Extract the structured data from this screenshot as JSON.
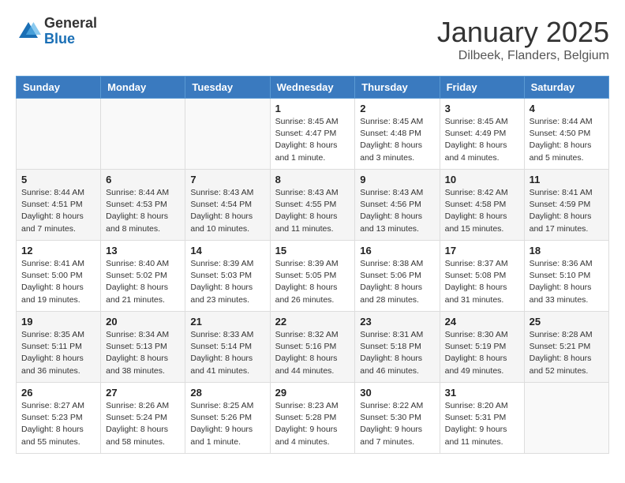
{
  "header": {
    "logo_general": "General",
    "logo_blue": "Blue",
    "month_title": "January 2025",
    "location": "Dilbeek, Flanders, Belgium"
  },
  "days_of_week": [
    "Sunday",
    "Monday",
    "Tuesday",
    "Wednesday",
    "Thursday",
    "Friday",
    "Saturday"
  ],
  "weeks": [
    [
      {
        "day": "",
        "info": ""
      },
      {
        "day": "",
        "info": ""
      },
      {
        "day": "",
        "info": ""
      },
      {
        "day": "1",
        "info": "Sunrise: 8:45 AM\nSunset: 4:47 PM\nDaylight: 8 hours\nand 1 minute."
      },
      {
        "day": "2",
        "info": "Sunrise: 8:45 AM\nSunset: 4:48 PM\nDaylight: 8 hours\nand 3 minutes."
      },
      {
        "day": "3",
        "info": "Sunrise: 8:45 AM\nSunset: 4:49 PM\nDaylight: 8 hours\nand 4 minutes."
      },
      {
        "day": "4",
        "info": "Sunrise: 8:44 AM\nSunset: 4:50 PM\nDaylight: 8 hours\nand 5 minutes."
      }
    ],
    [
      {
        "day": "5",
        "info": "Sunrise: 8:44 AM\nSunset: 4:51 PM\nDaylight: 8 hours\nand 7 minutes."
      },
      {
        "day": "6",
        "info": "Sunrise: 8:44 AM\nSunset: 4:53 PM\nDaylight: 8 hours\nand 8 minutes."
      },
      {
        "day": "7",
        "info": "Sunrise: 8:43 AM\nSunset: 4:54 PM\nDaylight: 8 hours\nand 10 minutes."
      },
      {
        "day": "8",
        "info": "Sunrise: 8:43 AM\nSunset: 4:55 PM\nDaylight: 8 hours\nand 11 minutes."
      },
      {
        "day": "9",
        "info": "Sunrise: 8:43 AM\nSunset: 4:56 PM\nDaylight: 8 hours\nand 13 minutes."
      },
      {
        "day": "10",
        "info": "Sunrise: 8:42 AM\nSunset: 4:58 PM\nDaylight: 8 hours\nand 15 minutes."
      },
      {
        "day": "11",
        "info": "Sunrise: 8:41 AM\nSunset: 4:59 PM\nDaylight: 8 hours\nand 17 minutes."
      }
    ],
    [
      {
        "day": "12",
        "info": "Sunrise: 8:41 AM\nSunset: 5:00 PM\nDaylight: 8 hours\nand 19 minutes."
      },
      {
        "day": "13",
        "info": "Sunrise: 8:40 AM\nSunset: 5:02 PM\nDaylight: 8 hours\nand 21 minutes."
      },
      {
        "day": "14",
        "info": "Sunrise: 8:39 AM\nSunset: 5:03 PM\nDaylight: 8 hours\nand 23 minutes."
      },
      {
        "day": "15",
        "info": "Sunrise: 8:39 AM\nSunset: 5:05 PM\nDaylight: 8 hours\nand 26 minutes."
      },
      {
        "day": "16",
        "info": "Sunrise: 8:38 AM\nSunset: 5:06 PM\nDaylight: 8 hours\nand 28 minutes."
      },
      {
        "day": "17",
        "info": "Sunrise: 8:37 AM\nSunset: 5:08 PM\nDaylight: 8 hours\nand 31 minutes."
      },
      {
        "day": "18",
        "info": "Sunrise: 8:36 AM\nSunset: 5:10 PM\nDaylight: 8 hours\nand 33 minutes."
      }
    ],
    [
      {
        "day": "19",
        "info": "Sunrise: 8:35 AM\nSunset: 5:11 PM\nDaylight: 8 hours\nand 36 minutes."
      },
      {
        "day": "20",
        "info": "Sunrise: 8:34 AM\nSunset: 5:13 PM\nDaylight: 8 hours\nand 38 minutes."
      },
      {
        "day": "21",
        "info": "Sunrise: 8:33 AM\nSunset: 5:14 PM\nDaylight: 8 hours\nand 41 minutes."
      },
      {
        "day": "22",
        "info": "Sunrise: 8:32 AM\nSunset: 5:16 PM\nDaylight: 8 hours\nand 44 minutes."
      },
      {
        "day": "23",
        "info": "Sunrise: 8:31 AM\nSunset: 5:18 PM\nDaylight: 8 hours\nand 46 minutes."
      },
      {
        "day": "24",
        "info": "Sunrise: 8:30 AM\nSunset: 5:19 PM\nDaylight: 8 hours\nand 49 minutes."
      },
      {
        "day": "25",
        "info": "Sunrise: 8:28 AM\nSunset: 5:21 PM\nDaylight: 8 hours\nand 52 minutes."
      }
    ],
    [
      {
        "day": "26",
        "info": "Sunrise: 8:27 AM\nSunset: 5:23 PM\nDaylight: 8 hours\nand 55 minutes."
      },
      {
        "day": "27",
        "info": "Sunrise: 8:26 AM\nSunset: 5:24 PM\nDaylight: 8 hours\nand 58 minutes."
      },
      {
        "day": "28",
        "info": "Sunrise: 8:25 AM\nSunset: 5:26 PM\nDaylight: 9 hours\nand 1 minute."
      },
      {
        "day": "29",
        "info": "Sunrise: 8:23 AM\nSunset: 5:28 PM\nDaylight: 9 hours\nand 4 minutes."
      },
      {
        "day": "30",
        "info": "Sunrise: 8:22 AM\nSunset: 5:30 PM\nDaylight: 9 hours\nand 7 minutes."
      },
      {
        "day": "31",
        "info": "Sunrise: 8:20 AM\nSunset: 5:31 PM\nDaylight: 9 hours\nand 11 minutes."
      },
      {
        "day": "",
        "info": ""
      }
    ]
  ]
}
